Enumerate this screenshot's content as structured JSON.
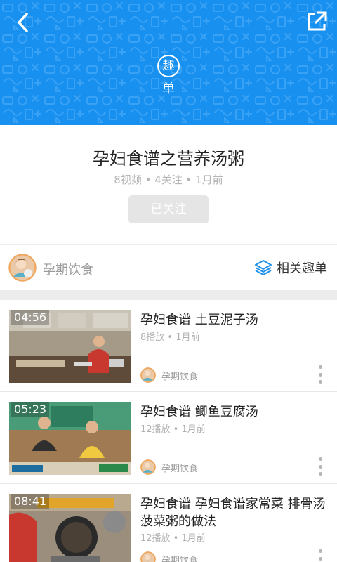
{
  "header": {
    "badge_char": "趣",
    "badge_sub": "单",
    "back_icon": "chevron-left-icon",
    "share_icon": "external-link-icon",
    "bg_color": "#1890f0"
  },
  "playlist": {
    "title": "孕妇食谱之营养汤粥",
    "meta": "8视频 • 4关注 • 1月前",
    "follow_label": "已关注"
  },
  "author_row": {
    "name": "孕期饮食",
    "related_label": "相关趣单",
    "related_icon": "layers-icon",
    "accent": "#1e90e8"
  },
  "videos": [
    {
      "title": "孕妇食谱 土豆泥子汤",
      "duration": "04:56",
      "meta": "8播放 • 1月前",
      "author": "孕期饮食"
    },
    {
      "title": "孕妇食谱 鲫鱼豆腐汤",
      "duration": "05:23",
      "meta": "12播放 • 1月前",
      "author": "孕期饮食"
    },
    {
      "title": "孕妇食谱 孕妇食谱家常菜 排骨汤 菠菜粥的做法",
      "duration": "08:41",
      "meta": "12播放 • 1月前",
      "author": "孕期饮食"
    }
  ]
}
